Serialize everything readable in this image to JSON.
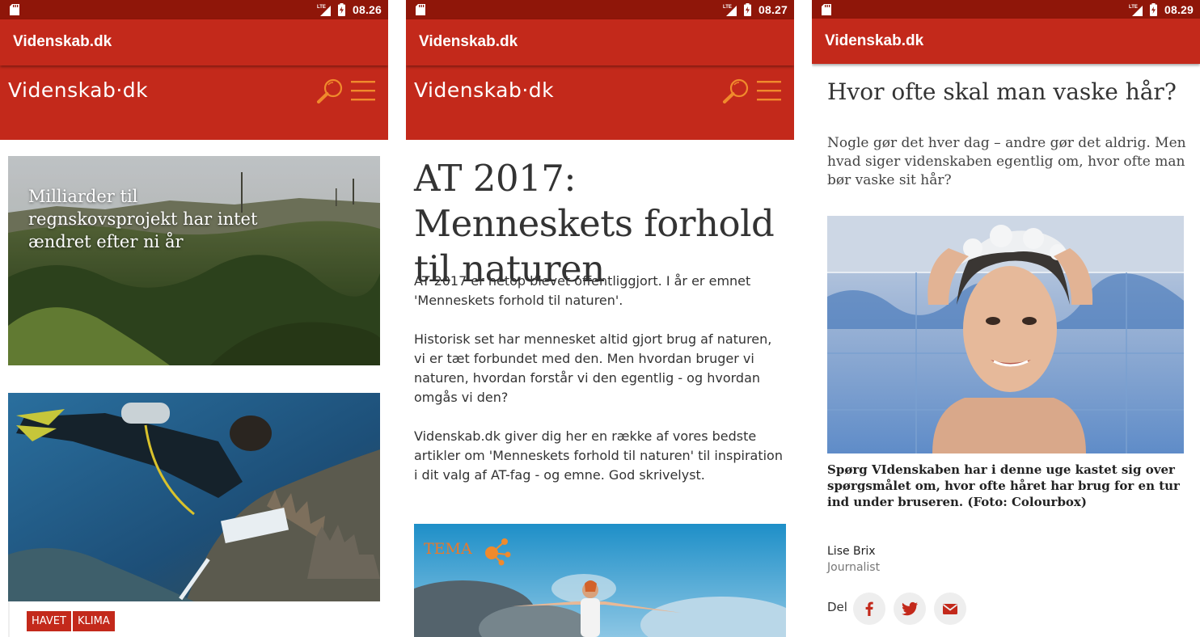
{
  "colors": {
    "status_bar": "#8f1609",
    "brand_red": "#c3291b",
    "accent_orange": "#f08a2c"
  },
  "app_title": "Videnskab.dk",
  "logo_text": "Videnskab·dk",
  "icons": {
    "search": "search-icon",
    "menu": "hamburger-menu-icon",
    "sd": "sd-card-icon",
    "lte": "lte-signal-icon",
    "battery": "battery-charging-icon"
  },
  "screens": [
    {
      "time": "08.26",
      "feed": [
        {
          "title": "Milliarder til regnskovsprojekt har intet ændret efter ni år"
        },
        {
          "title": ""
        }
      ],
      "tags": [
        "HAVET",
        "KLIMA"
      ]
    },
    {
      "time": "08.27",
      "article": {
        "title": "AT 2017: Menneskets forhold til naturen",
        "paragraphs": [
          "AT 2017 er netop blevet offentliggjort. I år er emnet 'Menneskets forhold til naturen'.",
          "Historisk set har mennesket altid gjort brug af naturen, vi er tæt forbundet med den. Men hvordan bruger vi naturen, hvordan forstår vi den egentlig - og hvordan omgås vi den?",
          "Videnskab.dk giver dig her en række af vores bedste artikler om 'Menneskets forhold til naturen' til inspiration i dit valg af AT-fag - og emne. God skrivelyst."
        ],
        "theme_label": "TEMA"
      }
    },
    {
      "time": "08.29",
      "article": {
        "title": "Hvor ofte skal man vaske hår?",
        "lead": "Nogle gør det hver dag – andre gør det aldrig. Men hvad siger videnskaben egentlig om, hvor ofte man bør vaske sit hår?",
        "caption": "Spørg VIdenskaben har i denne uge kastet sig over spørgsmålet om, hvor ofte håret har brug for en tur ind under bruseren. (Foto: Colourbox)",
        "author": "Lise Brix",
        "author_role": "Journalist",
        "share_label": "Del",
        "share_icons": [
          "facebook-icon",
          "twitter-icon",
          "mail-icon"
        ]
      }
    }
  ]
}
